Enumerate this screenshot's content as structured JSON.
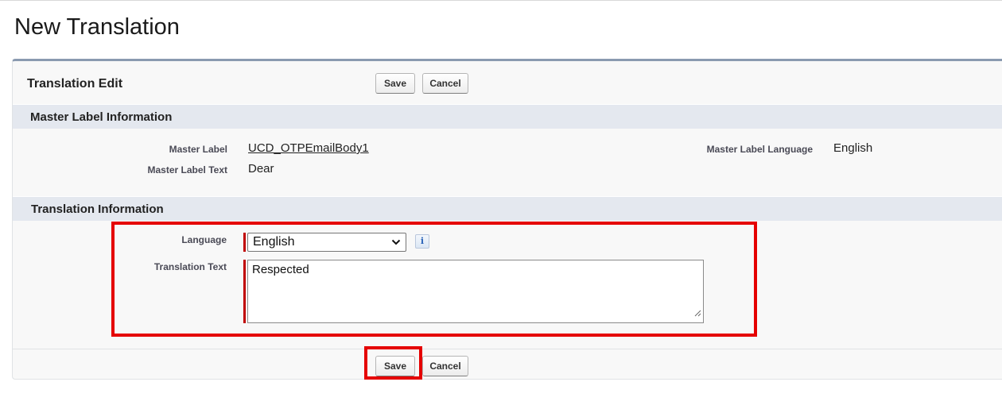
{
  "page": {
    "title": "New Translation"
  },
  "panel": {
    "title": "Translation Edit",
    "save_label": "Save",
    "cancel_label": "Cancel"
  },
  "master_section": {
    "title": "Master Label Information",
    "fields": {
      "master_label": {
        "label": "Master Label",
        "value": "UCD_OTPEmailBody1"
      },
      "master_label_text": {
        "label": "Master Label Text",
        "value": "Dear"
      },
      "master_label_language": {
        "label": "Master Label Language",
        "value": "English"
      }
    }
  },
  "translation_section": {
    "title": "Translation Information",
    "language": {
      "label": "Language",
      "selected": "English"
    },
    "translation_text": {
      "label": "Translation Text",
      "value": "Respected"
    }
  },
  "colors": {
    "required_marker": "#c00000",
    "highlight": "#e50000",
    "section_bar": "#e4e8ef",
    "panel_accent": "#8a9ab0"
  },
  "icons": {
    "language_help": "info-icon",
    "select_arrow": "chevron-down-icon",
    "textarea_resize": "resize-grip-icon"
  }
}
